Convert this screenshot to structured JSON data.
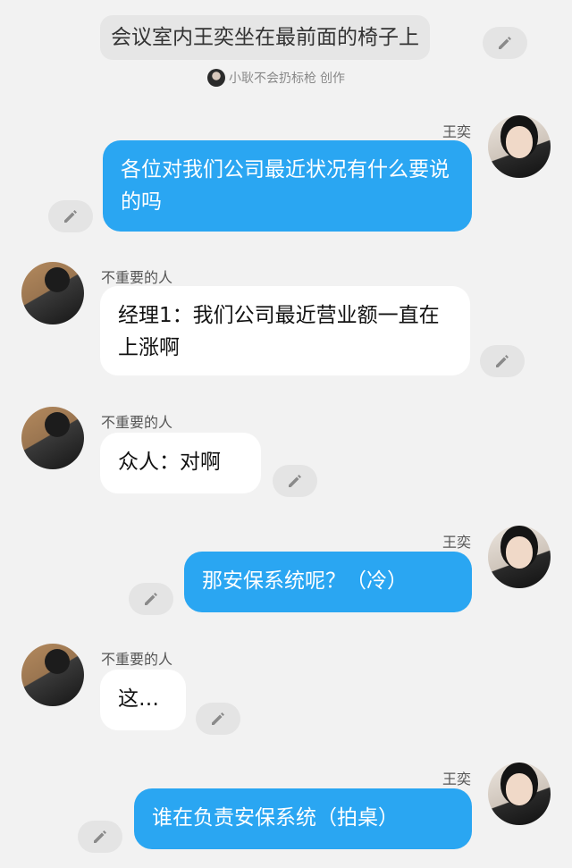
{
  "narration": {
    "text": "会议室内王奕坐在最前面的椅子上",
    "author": "小耿不会扔标枪",
    "author_suffix": "创作"
  },
  "messages": [
    {
      "speaker": "王奕",
      "side": "right",
      "text": "各位对我们公司最近状况有什么要说的吗"
    },
    {
      "speaker": "不重要的人",
      "side": "left",
      "text": "经理1：我们公司最近营业额一直在上涨啊"
    },
    {
      "speaker": "不重要的人",
      "side": "left",
      "text": "众人：对啊"
    },
    {
      "speaker": "王奕",
      "side": "right",
      "text": "那安保系统呢？（冷）"
    },
    {
      "speaker": "不重要的人",
      "side": "left",
      "text": "这…"
    },
    {
      "speaker": "王奕",
      "side": "right",
      "text": "谁在负责安保系统（拍桌）"
    }
  ],
  "icons": {
    "edit": "pencil-icon"
  },
  "colors": {
    "self_bubble": "#2aa6f2",
    "other_bubble": "#ffffff",
    "background": "#f2f2f2"
  }
}
